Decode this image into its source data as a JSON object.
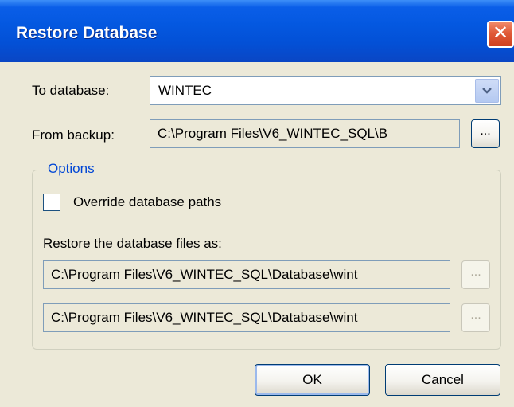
{
  "window": {
    "title": "Restore Database",
    "close_label": "✕"
  },
  "form": {
    "to_database_label": "To database:",
    "to_database_value": "WINTEC",
    "from_backup_label": "From backup:",
    "from_backup_value": "C:\\Program Files\\V6_WINTEC_SQL\\B",
    "browse_label": "..."
  },
  "options": {
    "title": "Options",
    "override_label": "Override database paths",
    "override_checked": false,
    "restore_as_label": "Restore the database files as:",
    "file1_value": "C:\\Program Files\\V6_WINTEC_SQL\\Database\\wint",
    "file2_value": "C:\\Program Files\\V6_WINTEC_SQL\\Database\\wint",
    "browse_label": "..."
  },
  "buttons": {
    "ok_label": "OK",
    "cancel_label": "Cancel"
  }
}
